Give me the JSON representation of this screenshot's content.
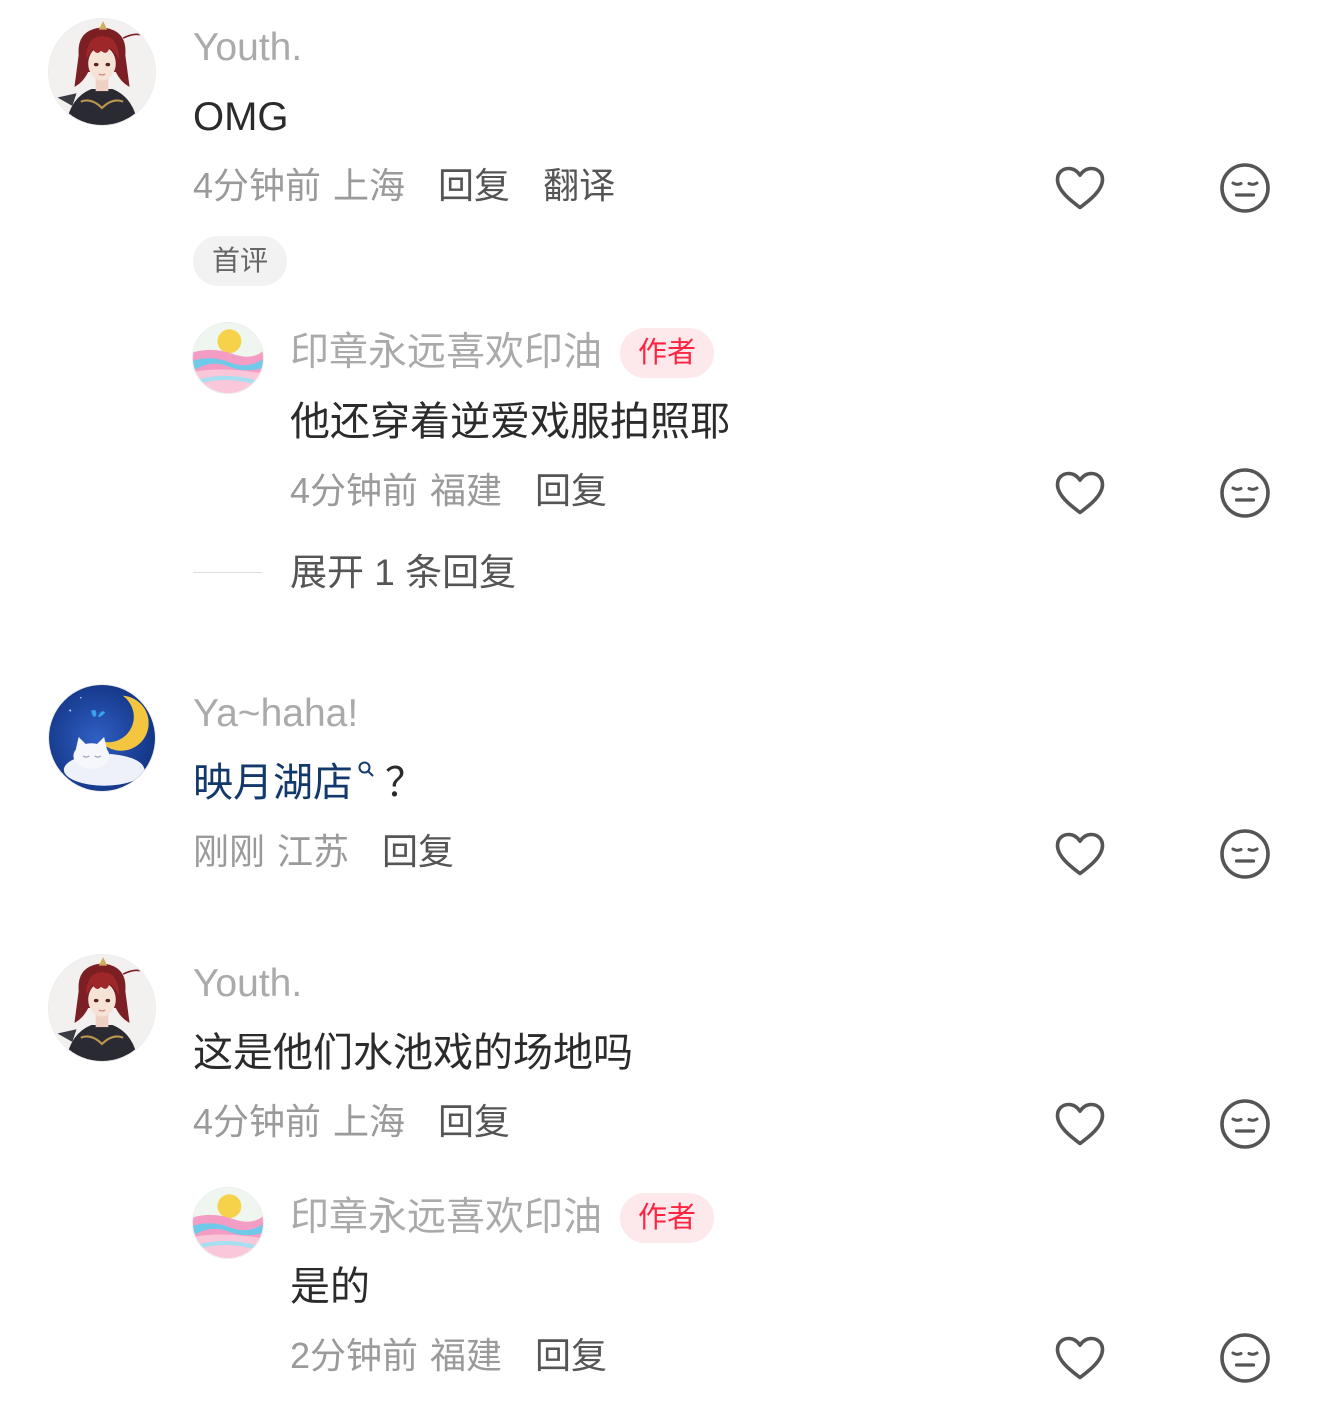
{
  "colors": {
    "accent": "#ff2442",
    "link": "#13386c",
    "text_primary": "#2b2b2b",
    "text_secondary": "#9a9a9a",
    "action": "#555555"
  },
  "icons": {
    "like": "heart-icon",
    "reaction": "emoji-face-icon",
    "link_search": "search-icon"
  },
  "comments": [
    {
      "username": "Youth.",
      "content": "OMG",
      "time": "4分钟前",
      "location": "上海",
      "reply_label": "回复",
      "translate_label": "翻译",
      "badge": "首评",
      "replies": [
        {
          "username": "印章永远喜欢印油",
          "author_tag": "作者",
          "content": "他还穿着逆爱戏服拍照耶",
          "time": "4分钟前",
          "location": "福建",
          "reply_label": "回复"
        }
      ],
      "expand_label": "展开 1 条回复"
    },
    {
      "username": "Ya~haha!",
      "content_link": "映月湖店",
      "content_suffix": "？",
      "time": "刚刚",
      "location": "江苏",
      "reply_label": "回复"
    },
    {
      "username": "Youth.",
      "content": "这是他们水池戏的场地吗",
      "time": "4分钟前",
      "location": "上海",
      "reply_label": "回复",
      "replies": [
        {
          "username": "印章永远喜欢印油",
          "author_tag": "作者",
          "content": "是的",
          "time": "2分钟前",
          "location": "福建",
          "reply_label": "回复"
        }
      ]
    }
  ]
}
